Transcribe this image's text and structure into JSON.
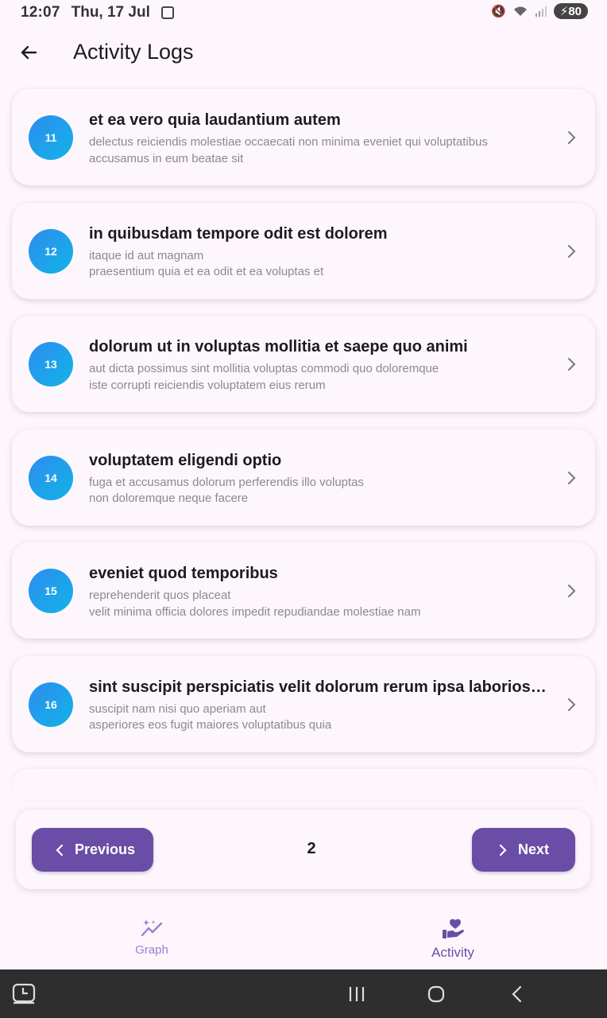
{
  "status": {
    "time": "12:07",
    "date": "Thu, 17 Jul",
    "battery": "80"
  },
  "header": {
    "title": "Activity Logs"
  },
  "logs": [
    {
      "id": "11",
      "title": "et ea vero quia laudantium autem",
      "lines": [
        "delectus reiciendis molestiae occaecati non minima eveniet qui voluptatibus",
        "accusamus in eum beatae sit"
      ]
    },
    {
      "id": "12",
      "title": "in quibusdam tempore odit est dolorem",
      "lines": [
        "itaque id aut magnam",
        "praesentium quia et ea odit et ea voluptas et"
      ]
    },
    {
      "id": "13",
      "title": "dolorum ut in voluptas mollitia et saepe quo animi",
      "lines": [
        "aut dicta possimus sint mollitia voluptas commodi quo doloremque",
        "iste corrupti reiciendis voluptatem eius rerum"
      ]
    },
    {
      "id": "14",
      "title": "voluptatem eligendi optio",
      "lines": [
        "fuga et accusamus dolorum perferendis illo voluptas",
        "non doloremque neque facere"
      ]
    },
    {
      "id": "15",
      "title": "eveniet quod temporibus",
      "lines": [
        "reprehenderit quos placeat",
        "velit minima officia dolores impedit repudiandae molestiae nam"
      ]
    },
    {
      "id": "16",
      "title": "sint suscipit perspiciatis velit dolorum rerum ipsa laboriosa...",
      "lines": [
        "suscipit nam nisi quo aperiam aut",
        "asperiores eos fugit maiores voluptatibus quia"
      ]
    }
  ],
  "pagination": {
    "previous_label": "Previous",
    "next_label": "Next",
    "current_page": "2"
  },
  "bottom_nav": {
    "graph_label": "Graph",
    "activity_label": "Activity"
  },
  "colors": {
    "primary": "#6a4da6",
    "badge_start": "#2d8cf0",
    "badge_end": "#12b4e6",
    "background": "#fdf7fd"
  },
  "icons": {
    "back": "arrow-left-icon",
    "chevron": "chevron-right-icon",
    "graph": "sparkle-chart-icon",
    "activity": "hand-heart-icon"
  }
}
